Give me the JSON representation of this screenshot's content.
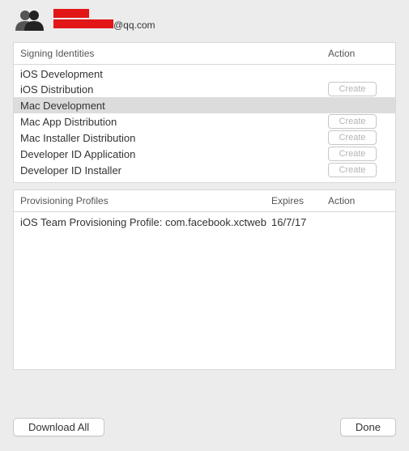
{
  "header": {
    "email_suffix": "@qq.com"
  },
  "signing": {
    "header_main": "Signing Identities",
    "header_action": "Action",
    "rows": [
      {
        "label": "iOS Development",
        "create": false,
        "selected": false
      },
      {
        "label": "iOS Distribution",
        "create": true,
        "selected": false
      },
      {
        "label": "Mac Development",
        "create": false,
        "selected": true
      },
      {
        "label": "Mac App Distribution",
        "create": true,
        "selected": false
      },
      {
        "label": "Mac Installer Distribution",
        "create": true,
        "selected": false
      },
      {
        "label": "Developer ID Application",
        "create": true,
        "selected": false
      },
      {
        "label": "Developer ID Installer",
        "create": true,
        "selected": false
      }
    ],
    "create_label": "Create"
  },
  "profiles": {
    "header_main": "Provisioning Profiles",
    "header_expires": "Expires",
    "header_action": "Action",
    "rows": [
      {
        "label": "iOS Team Provisioning Profile: com.facebook.xctweb",
        "expires": "16/7/17"
      }
    ]
  },
  "buttons": {
    "download_all": "Download All",
    "done": "Done"
  }
}
